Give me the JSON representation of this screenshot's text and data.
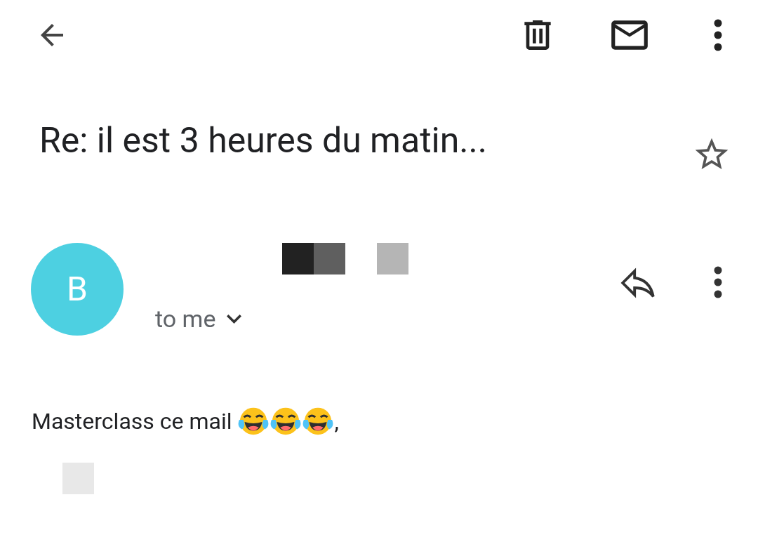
{
  "subject": "Re: il est 3 heures du matin...",
  "starred": false,
  "sender": {
    "initial": "B",
    "color": "#4dd0e1",
    "recipient": "to me",
    "redacted": [
      {
        "color": "#222222"
      },
      {
        "color": "#5f5f5f"
      },
      {
        "color": "#b5b5b5"
      }
    ]
  },
  "body_redacted": [
    {
      "color": "#e8e8e8"
    }
  ],
  "body": [
    {
      "kind": "text",
      "text": "Masterclass ce mail"
    },
    {
      "kind": "emoji"
    },
    {
      "kind": "emoji"
    },
    {
      "kind": "emoji"
    },
    {
      "kind": "text",
      "text": ","
    }
  ]
}
